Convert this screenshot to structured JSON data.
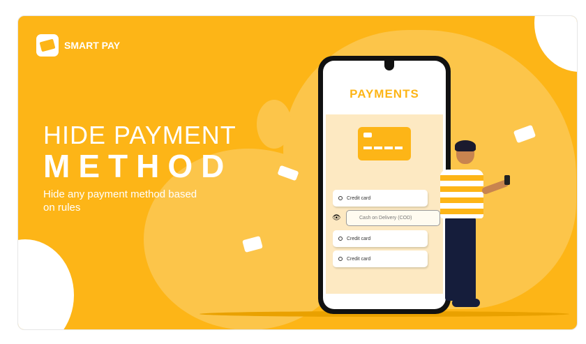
{
  "brand": {
    "name": "SMART PAY"
  },
  "hero": {
    "title_line1": "HIDE PAYMENT",
    "title_line2": "METHOD",
    "subtitle": "Hide any payment method based on rules"
  },
  "phone": {
    "title": "PAYMENTS",
    "options": [
      {
        "label": "Credit card",
        "icon": "radio-icon"
      },
      {
        "label": "Cash on Delivery (COD)",
        "icon": "eye-slash-icon",
        "hidden": true
      },
      {
        "label": "Credit card",
        "icon": "radio-icon"
      },
      {
        "label": "Credit card",
        "icon": "radio-icon"
      }
    ]
  },
  "colors": {
    "accent": "#FDB517",
    "light": "#FDE9C2"
  }
}
